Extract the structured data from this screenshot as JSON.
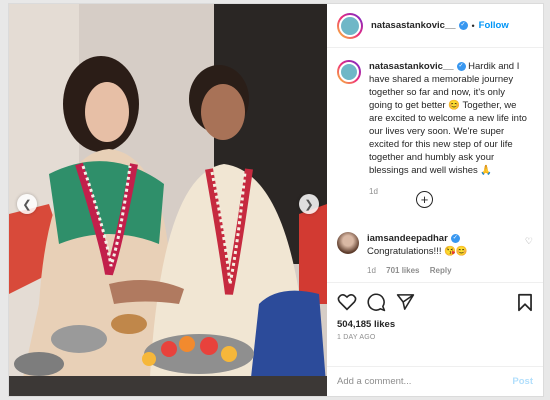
{
  "post": {
    "username": "natasastankovic__",
    "follow_label": "Follow",
    "dot": "•",
    "caption_user": "natasastankovic__",
    "caption_text": " Hardik and I have shared a memorable journey together so far and now, it's only going to get better 😊 Together, we are excited to welcome a new life into our lives very soon. We're super excited for this new step of our life together and humbly ask your blessings and well wishes 🙏",
    "caption_age": "1d",
    "load_more": "+",
    "reply": {
      "username": "iamsandeepadhar",
      "text": "Congratulations!!! 😘😊",
      "age": "1d",
      "likes": "701 likes",
      "reply_label": "Reply"
    },
    "likes": "504,185 likes",
    "time_ago": "1 DAY AGO",
    "add_comment_placeholder": "Add a comment...",
    "post_label": "Post",
    "icons": [
      "heart-icon",
      "comment-icon",
      "share-icon",
      "bookmark-icon",
      "verified-icon",
      "chevron-left-icon",
      "chevron-right-icon",
      "plus-circle-icon"
    ]
  },
  "colors": {
    "accent": "#0095f6",
    "verified": "#3897f0",
    "muted": "#8e8e8e"
  }
}
